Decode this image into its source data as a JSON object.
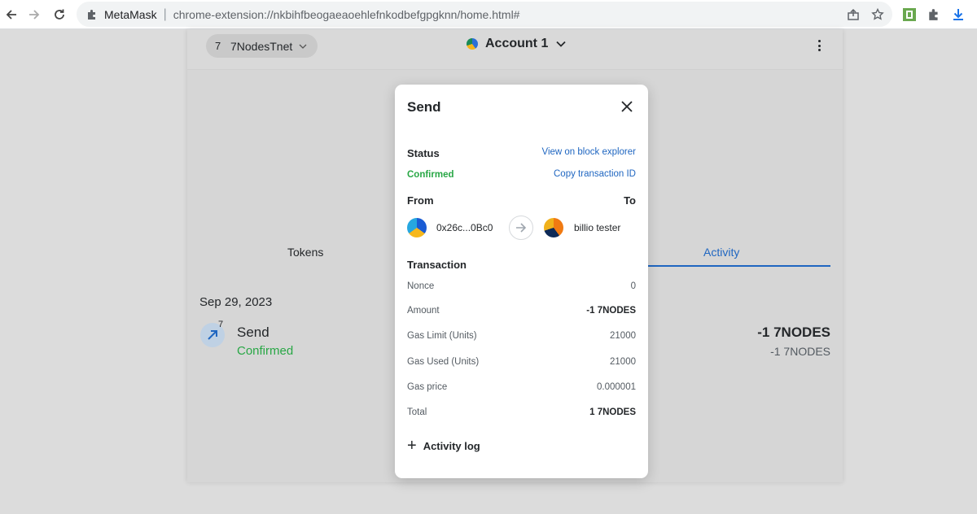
{
  "browser": {
    "site_name": "MetaMask",
    "url": "chrome-extension://nkbihfbeogaeaoehlefnkodbefgpgknn/home.html#",
    "separator": "|"
  },
  "header": {
    "network_number": "7",
    "network_name": "7NodesTnet",
    "account_name": "Account 1"
  },
  "tabs": {
    "tokens": "Tokens",
    "activity": "Activity"
  },
  "activity": {
    "date": "Sep 29, 2023",
    "badge": "7",
    "title": "Send",
    "status": "Confirmed",
    "amount": "-1 7NODES",
    "amount_secondary": "-1 7NODES"
  },
  "modal": {
    "title": "Send",
    "status_label": "Status",
    "status_value": "Confirmed",
    "view_explorer_link": "View on block explorer",
    "copy_tx_link": "Copy transaction ID",
    "from_label": "From",
    "to_label": "To",
    "from_address": "0x26c...0Bc0",
    "to_address": "billio tester",
    "transaction_heading": "Transaction",
    "rows": [
      {
        "label": "Nonce",
        "value": "0"
      },
      {
        "label": "Amount",
        "value": "-1 7NODES"
      },
      {
        "label": "Gas Limit (Units)",
        "value": "21000"
      },
      {
        "label": "Gas Used (Units)",
        "value": "21000"
      },
      {
        "label": "Gas price",
        "value": "0.000001"
      },
      {
        "label": "Total",
        "value": "1 7NODES"
      }
    ],
    "activity_log": "Activity log",
    "activity_log_icon": "+"
  },
  "colors": {
    "accent_blue": "#1f66c1",
    "success_green": "#28a745"
  }
}
